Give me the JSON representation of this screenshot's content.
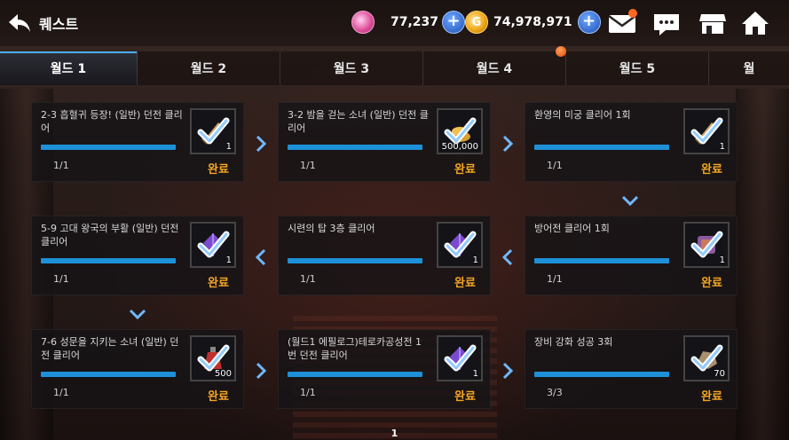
{
  "header": {
    "title": "퀘스트",
    "gems": "77,237",
    "gold": "74,978,971",
    "gold_symbol": "G"
  },
  "tabs": [
    {
      "label": "월드 1",
      "active": true
    },
    {
      "label": "월드 2"
    },
    {
      "label": "월드 3"
    },
    {
      "label": "월드 4"
    },
    {
      "label": "월드 5"
    },
    {
      "label": "월"
    }
  ],
  "quests": [
    {
      "name": "2-3 흡혈귀 등장! (일반) 던전 클리어",
      "progress": "1/1",
      "status": "완료",
      "reward_qty": "1",
      "reward_icon": "sword-icon"
    },
    {
      "name": "3-2 밤을 걷는 소녀 (일반) 던전 클리어",
      "progress": "1/1",
      "status": "완료",
      "reward_qty": "500,000",
      "reward_icon": "coin-pile-icon"
    },
    {
      "name": "환영의 미궁 클리어 1회",
      "progress": "1/1",
      "status": "완료",
      "reward_qty": "1",
      "reward_icon": "sword-icon"
    },
    {
      "name": "5-9 고대 왕국의 부활 (일반) 던전 클리어",
      "progress": "1/1",
      "status": "완료",
      "reward_qty": "1",
      "reward_icon": "crystal-icon"
    },
    {
      "name": "시련의 탑 3층 클리어",
      "progress": "1/1",
      "status": "완료",
      "reward_qty": "1",
      "reward_icon": "crystal-icon"
    },
    {
      "name": "방어전 클리어 1회",
      "progress": "1/1",
      "status": "완료",
      "reward_qty": "1",
      "reward_icon": "scroll-icon"
    },
    {
      "name": "7-6 성문을 지키는 소녀 (일반) 던전 클리어",
      "progress": "1/1",
      "status": "완료",
      "reward_qty": "500",
      "reward_icon": "potion-icon"
    },
    {
      "name": "(월드1 에필로그)테로카공성전 1번 던전 클리어",
      "progress": "1/1",
      "status": "완료",
      "reward_qty": "1",
      "reward_icon": "crystal-icon"
    },
    {
      "name": "장비 강화 성공 3회",
      "progress": "3/3",
      "status": "완료",
      "reward_qty": "70",
      "reward_icon": "stone-icon"
    }
  ],
  "page": "1",
  "colors": {
    "accent": "#1d90d8",
    "complete": "#f5a623",
    "tab_highlight": "#4ab0ff"
  }
}
